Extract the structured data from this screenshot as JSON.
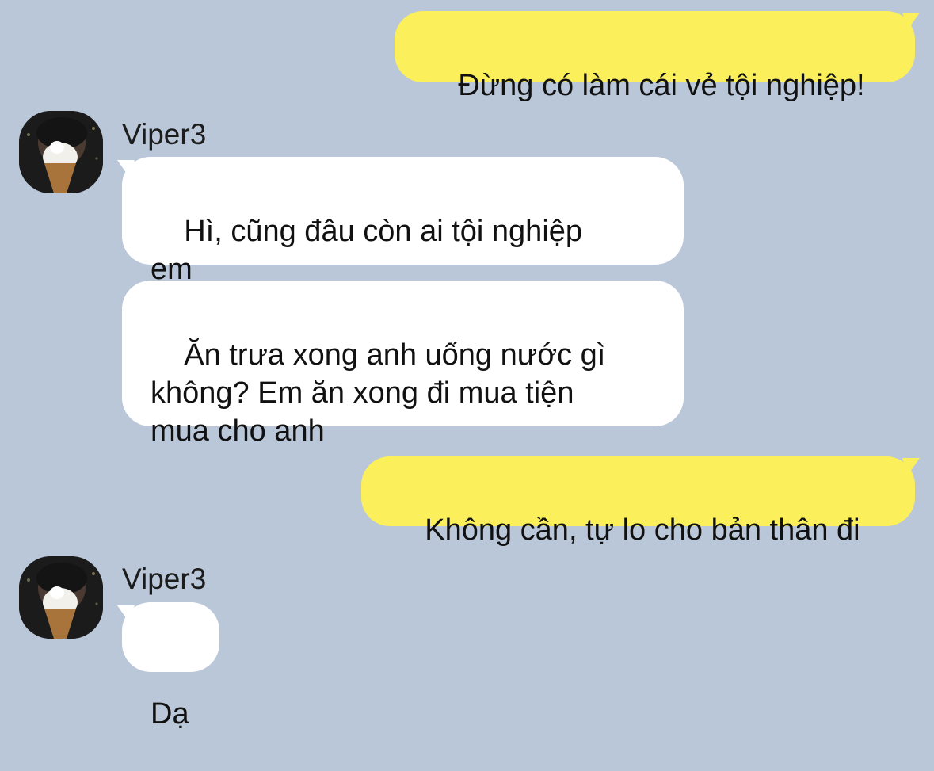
{
  "messages": [
    {
      "direction": "out",
      "text": "Đừng có làm cái vẻ tội nghiệp!"
    },
    {
      "direction": "in",
      "sender": "Viper3",
      "text": "Hì, cũng đâu còn ai tội nghiệp\nem"
    },
    {
      "direction": "in",
      "text": "Ăn trưa xong anh uống nước gì\nkhông? Em ăn xong đi mua tiện\nmua cho anh"
    },
    {
      "direction": "out",
      "text": "Không cần, tự lo cho bản thân đi"
    },
    {
      "direction": "in",
      "sender": "Viper3",
      "text": "Dạ"
    }
  ],
  "avatar": {
    "icon": "contact-avatar-icon"
  },
  "colors": {
    "background": "#b9c7d9",
    "outgoing_bubble": "#fbef5c",
    "incoming_bubble": "#ffffff"
  }
}
